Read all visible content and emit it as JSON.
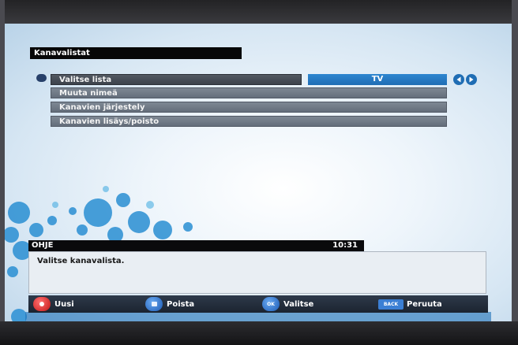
{
  "menu": {
    "title": "Kanavalistat",
    "items": [
      {
        "label": "Valitse lista"
      },
      {
        "label": "Muuta nimeä"
      },
      {
        "label": "Kanavien järjestely"
      },
      {
        "label": "Kanavien lisäys/poisto"
      }
    ],
    "selected_value": "TV",
    "arrow_icons": [
      "arrow-left-icon",
      "arrow-right-icon"
    ]
  },
  "help": {
    "title": "OHJE",
    "time": "10:31",
    "text": "Valitse kanavalista."
  },
  "footer": {
    "buttons": [
      {
        "key": "red",
        "label": "Uusi",
        "icon": "red-button-icon"
      },
      {
        "key": "blue",
        "label": "Poista",
        "icon": "blue-square-button-icon"
      },
      {
        "key": "ok",
        "key_label": "OK",
        "label": "Valitse",
        "icon": "ok-button-icon"
      },
      {
        "key": "back",
        "key_label": "BACK",
        "label": "Peruuta",
        "icon": "back-key-icon"
      }
    ]
  },
  "colors": {
    "accent": "#1f6db4",
    "title_bar": "#070707",
    "menu_dark": "#3c424b",
    "menu_mid": "#646e7b",
    "red_button": "#c21515",
    "blue_button": "#1c5bb5"
  }
}
